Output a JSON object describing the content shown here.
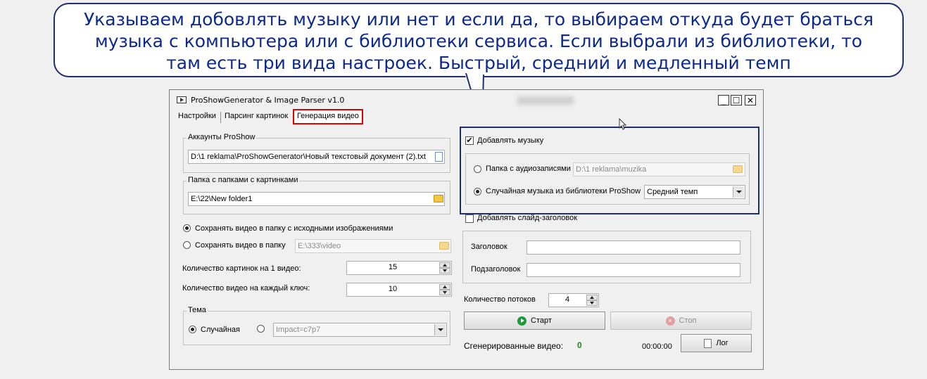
{
  "callout": {
    "text": "Указываем добовлять музыку или нет и если да, то выбираем откуда будет браться\nмузыка с компьютера или с библиотеки сервиса. Если выбрали из библиотеки, то\nтам  есть три вида настроек. Быстрый, средний и медленный темп"
  },
  "window": {
    "title": "ProShowGenerator & Image Parser v1.0",
    "controls": {
      "minimize": "_",
      "maximize": "☐",
      "close": "✕"
    }
  },
  "tabs": [
    {
      "label": "Настройки"
    },
    {
      "label": "Парсинг картинок"
    },
    {
      "label": "Генерация видео",
      "active": true
    }
  ],
  "left": {
    "accounts_group": "Аккаунты ProShow",
    "accounts_path": "D:\\1 reklama\\ProShowGenerator\\Новый текстовый документ (2).txt",
    "folders_group": "Папка с папками с картинками",
    "folders_path": "E:\\22\\New folder1",
    "save_source_label": "Сохранять видео в папку с исходными изображениями",
    "save_folder_label": "Сохранять видео в папку",
    "save_folder_path": "E:\\333\\video",
    "images_per_video_label": "Количество картинок на 1 видео:",
    "images_per_video_value": "15",
    "videos_per_key_label": "Количество видео на каждый ключ:",
    "videos_per_key_value": "10",
    "theme_group": "Тема",
    "theme_random_label": "Случайная",
    "theme_select_value": "Impact=c7p7"
  },
  "right": {
    "add_music_label": "Добавлять музыку",
    "audio_folder_label": "Папка с аудиозаписями",
    "audio_folder_path": "D:\\1 reklama\\muzika",
    "library_music_label": "Случайная музыка из библиотеки ProShow",
    "tempo_value": "Средний темп",
    "add_title_slide_label": "Добавлять слайд-заголовок",
    "title_label": "Заголовок",
    "subtitle_label": "Подзаголовок",
    "threads_label": "Количество потоков",
    "threads_value": "4",
    "start_label": "Старт",
    "stop_label": "Стоп",
    "generated_label": "Сгенерированные видео:",
    "generated_count": "0",
    "timer": "00:00:00",
    "log_label": "Лог"
  },
  "colors": {
    "callout_text": "#0c2a8a",
    "callout_border": "#1f2f6b",
    "active_tab_border": "#e00000",
    "generated_count": "#1a8a1a"
  }
}
